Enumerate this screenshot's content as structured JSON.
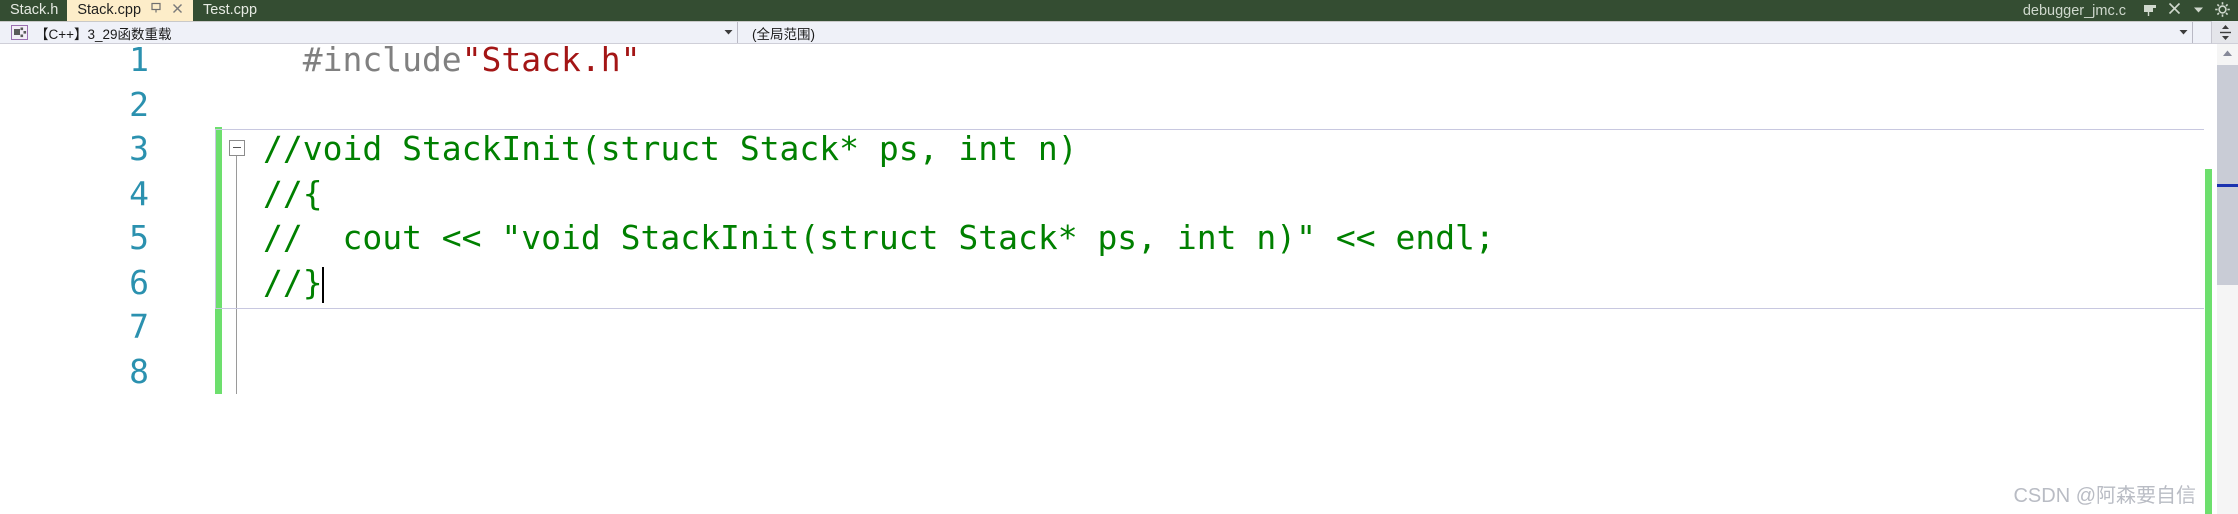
{
  "tabs": [
    {
      "label": "Stack.h",
      "active": false,
      "pinned": false,
      "closable": false
    },
    {
      "label": "Stack.cpp",
      "active": true,
      "pinned": true,
      "closable": true
    },
    {
      "label": "Test.cpp",
      "active": false,
      "pinned": false,
      "closable": false
    }
  ],
  "tabstrip_right": {
    "document_label": "debugger_jmc.c",
    "pin_icon": "pin-icon",
    "close_icon": "close-icon",
    "chevron_icon": "chevron-down-icon",
    "gear_icon": "gear-icon",
    "pin_glyph": "⌸",
    "close_glyph": "✕",
    "chevron_glyph": "▼",
    "gear_glyph": "⚙"
  },
  "navbar": {
    "project_icon": "project-selector-icon",
    "project_value": "【C++】3_29函数重载",
    "scope_value": "(全局范围)",
    "arrow_glyph": "▼",
    "grip_glyph": "↕"
  },
  "editor": {
    "lines": [
      {
        "number": "1",
        "changebar": false,
        "collapse": false,
        "segments": [
          {
            "text": "  #include",
            "kind": "preprocessor"
          },
          {
            "text": "\"Stack.h\"",
            "kind": "string"
          }
        ]
      },
      {
        "number": "2",
        "changebar": false,
        "collapse": false,
        "segments": []
      },
      {
        "number": "3",
        "changebar": true,
        "collapse": true,
        "segments": [
          {
            "text": "//void StackInit(struct Stack* ps, int n)",
            "kind": "comment"
          }
        ]
      },
      {
        "number": "4",
        "changebar": true,
        "collapse": false,
        "segments": [
          {
            "text": "//{",
            "kind": "comment"
          }
        ]
      },
      {
        "number": "5",
        "changebar": true,
        "collapse": false,
        "segments": [
          {
            "text": "//  cout << \"void StackInit(struct Stack* ps, int n)\" << endl;",
            "kind": "comment"
          }
        ]
      },
      {
        "number": "6",
        "changebar": true,
        "collapse": false,
        "segments": [
          {
            "text": "//}",
            "kind": "comment"
          }
        ]
      },
      {
        "number": "7",
        "changebar": true,
        "collapse": false,
        "segments": []
      },
      {
        "number": "8",
        "changebar": true,
        "collapse": false,
        "segments": []
      }
    ],
    "caret_line": "6",
    "colors": {
      "preprocessor": "#808080",
      "string": "#a31515",
      "comment": "#008000",
      "line_number": "#2b91af",
      "change_bar": "#6ddf6d",
      "tab_active_bg": "#fdedc9",
      "tabstrip_bg": "#344d32"
    }
  },
  "scrollbar": {
    "up_arrow_glyph": "▲",
    "down_arrow_glyph": "▼",
    "edit_marker_color": "#1c33b0",
    "change_marker_color": "#6ddf6d"
  },
  "watermark": {
    "text": "CSDN @阿森要自信"
  }
}
